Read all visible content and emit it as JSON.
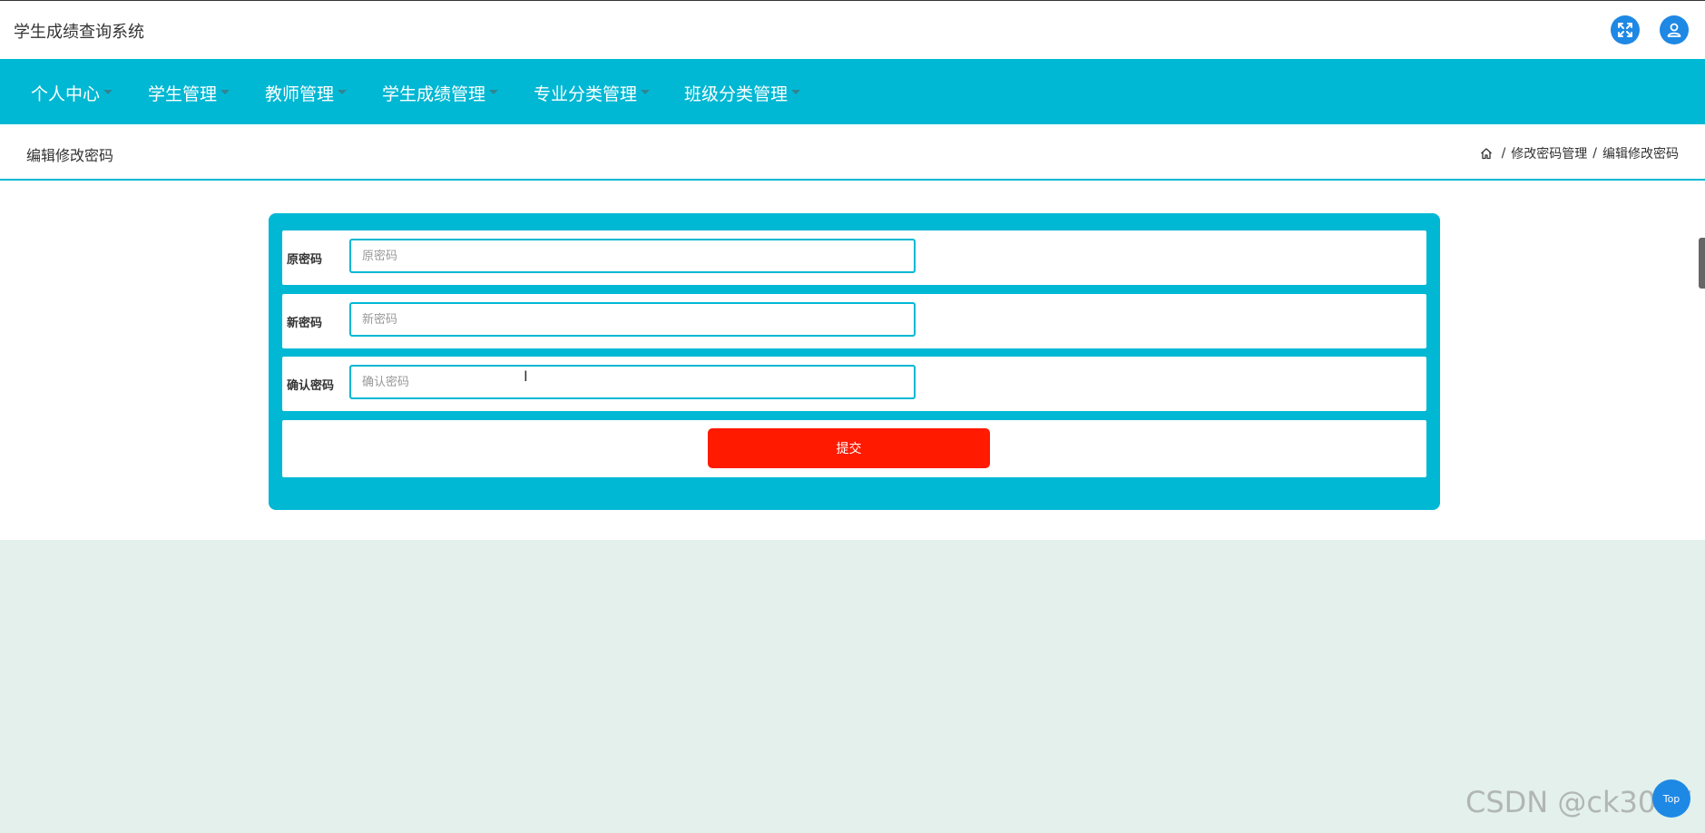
{
  "app": {
    "title": "学生成绩查询系统"
  },
  "header": {
    "icons": [
      "expand-icon",
      "user-icon"
    ],
    "accent_color": "#1e88e5"
  },
  "nav": {
    "background": "#00b8d4",
    "items": [
      {
        "label": "个人中心"
      },
      {
        "label": "学生管理"
      },
      {
        "label": "教师管理"
      },
      {
        "label": "学生成绩管理"
      },
      {
        "label": "专业分类管理"
      },
      {
        "label": "班级分类管理"
      }
    ]
  },
  "page": {
    "title": "编辑修改密码"
  },
  "breadcrumb": {
    "items": [
      "修改密码管理",
      "编辑修改密码"
    ],
    "separator": "/"
  },
  "form": {
    "fields": [
      {
        "label": "原密码",
        "placeholder": "原密码",
        "value": ""
      },
      {
        "label": "新密码",
        "placeholder": "新密码",
        "value": ""
      },
      {
        "label": "确认密码",
        "placeholder": "确认密码",
        "value": ""
      }
    ],
    "submit_label": "提交",
    "submit_color": "#ff1a00"
  },
  "back_to_top": {
    "label": "Top"
  },
  "watermark": {
    "text": "CSDN @ck3017"
  }
}
